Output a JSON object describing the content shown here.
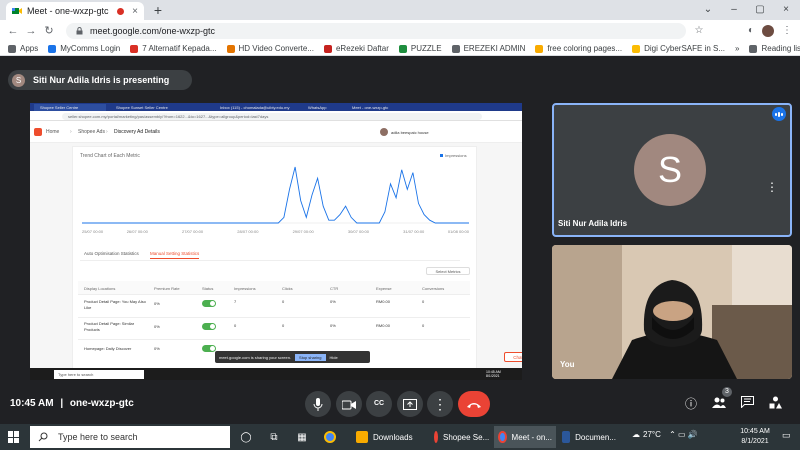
{
  "browser": {
    "tab": {
      "title": "Meet - one-wxzp-gtc",
      "close_glyph": "×"
    },
    "new_tab_glyph": "+",
    "window_controls": [
      "⌄",
      "–",
      "▢",
      "×"
    ],
    "nav": {
      "back": "←",
      "forward": "→",
      "reload": "↻"
    },
    "url": "meet.google.com/one-wxzp-gtc",
    "toolbar_icons": {
      "star": "☆",
      "extensions": "◐",
      "menu": "⋮"
    }
  },
  "bookmarks": {
    "items": [
      {
        "label": "Apps",
        "color": "#5f6368"
      },
      {
        "label": "MyComms Login",
        "color": "#1a73e8"
      },
      {
        "label": "7 Alternatif Kepada...",
        "color": "#d93025"
      },
      {
        "label": "HD Video Converte...",
        "color": "#e37400"
      },
      {
        "label": "eRezeki Daftar",
        "color": "#c5221f"
      },
      {
        "label": "PUZZLE",
        "color": "#1e8e3e"
      },
      {
        "label": "EREZEKI ADMIN",
        "color": "#5f6368"
      },
      {
        "label": "free coloring pages...",
        "color": "#f9ab00"
      },
      {
        "label": "Digi CyberSAFE in S...",
        "color": "#fbbc04"
      }
    ],
    "more_glyph": "»",
    "reading_list": "Reading list"
  },
  "meet": {
    "presenting_initial": "S",
    "presenting_text": "Siti Nur Adila Idris is presenting",
    "time": "10:45 AM",
    "separator": "|",
    "meeting_code": "one-wxzp-gtc",
    "participants": [
      {
        "name": "Siti Nur Adila Idris",
        "initial": "S",
        "color": "#a1887f"
      },
      {
        "name": "You"
      }
    ],
    "more_glyph": "⋮",
    "people_count": "3",
    "controls": {
      "mic": "🎤",
      "camera": "▣",
      "captions": "CC",
      "present": "⇧",
      "more": "⋮",
      "leave": "☎"
    },
    "right_controls": {
      "info": "ⓘ",
      "people": "👥",
      "chat": "▤",
      "activities": "⚇"
    }
  },
  "shared_screen": {
    "tabs": [
      "Shopee Seller Centre",
      "Shopee Sunset Seller Centre",
      "Inbox (115) - chomalada@uibty.edu.my",
      "WhatsApp",
      "Meet - one-wxzp-gtc"
    ],
    "url": "seller.shopee.com.my/portal/marketing/pas/assembly/?from=1622...&to=1627...&type=allgroup&period=last7days",
    "breadcrumb": [
      "Home",
      "Shopee Ads",
      "Discovery Ad Details"
    ],
    "shop_name": "adila beespaic house",
    "chart_title": "Trend Chart of Each Metric",
    "legend": "Impressions",
    "x_ticks": [
      "25/07 00:00",
      "26/07 00:00",
      "27/07 00:00",
      "28/07 00:00",
      "29/07 00:00",
      "30/07 00:00",
      "31/07 00:00",
      "01/08 00:00"
    ],
    "subtabs": [
      "Auto Optimisation Statistics",
      "Manual Setting Statistics"
    ],
    "select_metrics": "Select Metrics",
    "table_headers": [
      "Display Locations",
      "Premium Rate",
      "Status",
      "Impressions",
      "Clicks",
      "CTR",
      "Expense",
      "Conversions"
    ],
    "rows": [
      {
        "location": "Product Detail Page: You May Also Like",
        "premium": "0%",
        "impressions": "7",
        "clicks": "0",
        "ctr": "0%",
        "expense": "RM0.00",
        "conversions": "0"
      },
      {
        "location": "Product Detail Page: Similar Products",
        "premium": "0%",
        "impressions": "0",
        "clicks": "0",
        "ctr": "0%",
        "expense": "RM0.00",
        "conversions": "0"
      },
      {
        "location": "Homepage: Daily Discover",
        "premium": "0%",
        "impressions": "0",
        "clicks": "0",
        "ctr": "0%",
        "expense": "RM0.00",
        "conversions": "0"
      }
    ],
    "notice": {
      "text": "meet.google.com is sharing your screen.",
      "stop": "Stop sharing",
      "hide": "Hide"
    },
    "chat": "Chat",
    "taskbar_search": "Type here to search",
    "clock": {
      "time": "10:45 AM",
      "date": "8/1/2021"
    }
  },
  "chart_data": {
    "type": "line",
    "legend": "Impressions",
    "x": [
      "25/07 00:00",
      "26/07 00:00",
      "27/07 00:00",
      "28/07 00:00",
      "29/07 00:00",
      "30/07 00:00",
      "31/07 00:00",
      "01/08 00:00"
    ],
    "series": [
      {
        "name": "Impressions",
        "values": [
          0,
          0,
          0,
          0,
          0,
          0,
          0,
          0,
          0,
          0,
          0,
          0,
          0,
          0,
          0,
          0,
          0,
          0,
          0,
          0,
          0,
          0,
          0,
          0,
          0,
          0,
          0,
          0,
          0,
          0,
          0,
          0,
          0,
          0,
          0,
          0,
          0.1,
          0.6,
          1,
          0.4,
          0.1,
          0.5,
          0.8,
          0.3,
          0.05,
          0.05,
          0.15,
          0.3,
          0.1,
          0,
          0,
          0,
          0,
          0,
          0.2,
          0.7,
          0.45,
          0.95,
          0.6,
          0.9,
          0.35,
          0.15,
          0.05,
          0,
          0,
          0,
          0,
          0,
          0,
          0
        ]
      }
    ]
  },
  "taskbar": {
    "search_placeholder": "Type here to search",
    "pinned": [
      "◯",
      "⧉",
      "▦"
    ],
    "apps": [
      {
        "label": "",
        "color": "#4285f4"
      },
      {
        "label": "Downloads",
        "color": "#f9ab00"
      },
      {
        "label": "Shopee Se...",
        "color": "#4285f4"
      },
      {
        "label": "Meet - on...",
        "color": "#4285f4"
      },
      {
        "label": "Documen...",
        "color": "#2b579a"
      }
    ],
    "weather": "27°C",
    "tray": "⌃ ▭ 🔊",
    "clock": {
      "time": "10:45 AM",
      "date": "8/1/2021"
    }
  }
}
